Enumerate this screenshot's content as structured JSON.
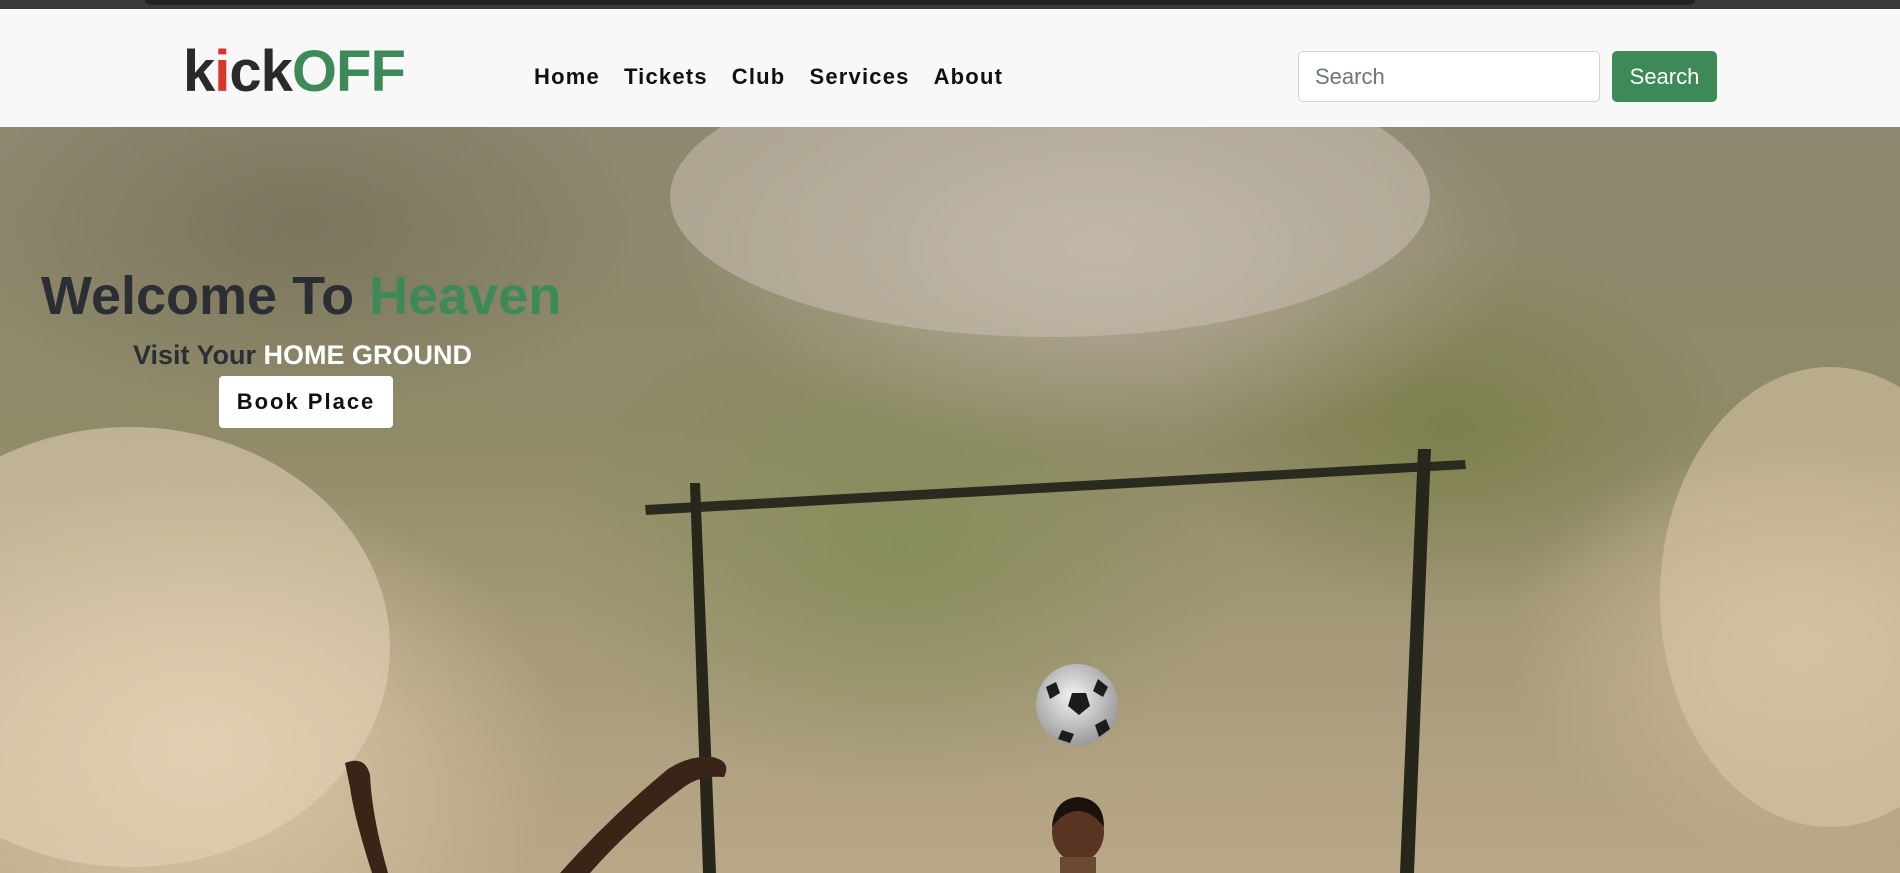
{
  "brand": {
    "logo_part1": "k",
    "logo_i": "i",
    "logo_part2": "ck",
    "logo_part3": "OFF"
  },
  "nav": {
    "items": [
      {
        "label": "Home"
      },
      {
        "label": "Tickets"
      },
      {
        "label": "Club"
      },
      {
        "label": "Services"
      },
      {
        "label": "About"
      }
    ]
  },
  "search": {
    "placeholder": "Search",
    "value": "",
    "button_label": "Search"
  },
  "hero": {
    "title_prefix": "Welcome To ",
    "title_accent": "Heaven",
    "subtitle_prefix": "Visit Your ",
    "subtitle_highlight": "HOME GROUND",
    "cta_label": "Book Place"
  },
  "colors": {
    "accent": "#3d8a58",
    "logo_red": "#d9362b",
    "text_dark": "#2b2e33",
    "navbar_bg": "#f8f8f8"
  },
  "icons": {
    "hero_image": "football-goal-photo"
  }
}
